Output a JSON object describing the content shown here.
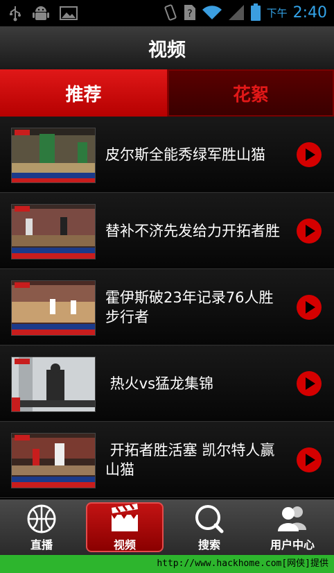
{
  "status_bar": {
    "time_prefix": "下午",
    "time": "2:40"
  },
  "header": {
    "title": "视频"
  },
  "tabs": [
    {
      "label": "推荐"
    },
    {
      "label": "花絮"
    }
  ],
  "videos": [
    {
      "title": "皮尔斯全能秀绿军胜山猫"
    },
    {
      "title": "替补不济先发给力开拓者胜"
    },
    {
      "title": "霍伊斯破23年记录76人胜步行者"
    },
    {
      "title": " 热火vs猛龙集锦"
    },
    {
      "title": " 开拓者胜活塞 凯尔特人赢山猫"
    }
  ],
  "bottom_nav": [
    {
      "label": "直播",
      "icon": "basketball-icon"
    },
    {
      "label": "视频",
      "icon": "clapperboard-icon"
    },
    {
      "label": "搜索",
      "icon": "search-icon"
    },
    {
      "label": "用户中心",
      "icon": "users-icon"
    }
  ],
  "footer": {
    "text": "http://www.hackhome.com[网侠]提供"
  },
  "colors": {
    "accent": "#d40000",
    "status_blue": "#33a3e8",
    "footer_green": "#2db52d"
  }
}
